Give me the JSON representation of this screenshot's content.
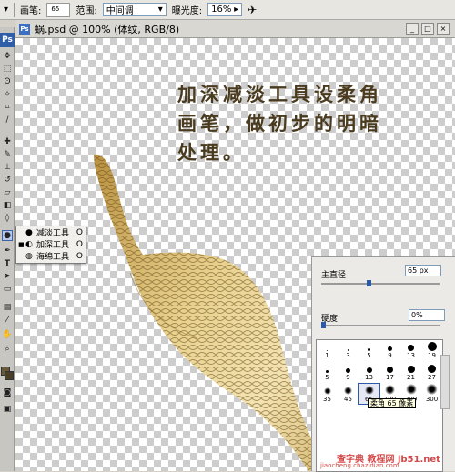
{
  "options_bar": {
    "brush_label": "画笔:",
    "brush_size": "65",
    "range_label": "范围:",
    "range_value": "中间调",
    "exposure_label": "曝光度:",
    "exposure_value": "16%"
  },
  "tools": {
    "ps_badge": "Ps",
    "flyout": [
      {
        "label": "减淡工具",
        "key": "O",
        "selected": false
      },
      {
        "label": "加深工具",
        "key": "O",
        "selected": true
      },
      {
        "label": "海绵工具",
        "key": "O",
        "selected": false
      }
    ]
  },
  "document": {
    "title": "蜗.psd @ 100% (体纹, RGB/8)",
    "caption_lines": [
      "加深减淡工具设柔角",
      "画笔，做初步的明暗",
      "处理。"
    ]
  },
  "brush_panel": {
    "master_diameter_label": "主直径",
    "master_diameter_value": "65 px",
    "hardness_label": "硬度:",
    "hardness_value": "0%",
    "presets": [
      "1",
      "3",
      "5",
      "9",
      "13",
      "19",
      "5",
      "9",
      "13",
      "17",
      "21",
      "27",
      "35",
      "45",
      "65",
      "100",
      "200",
      "300"
    ],
    "tooltip": "柔角 65 像素"
  },
  "watermark": {
    "line1": "查字典 教程网 jb51.net",
    "line2": "jiaocheng.chazidian.com"
  },
  "colors": {
    "accent": "#2b5aa8",
    "caption": "#4a3b1f",
    "leaf_light": "#f0dca0",
    "leaf_dark": "#8a6a2a"
  }
}
